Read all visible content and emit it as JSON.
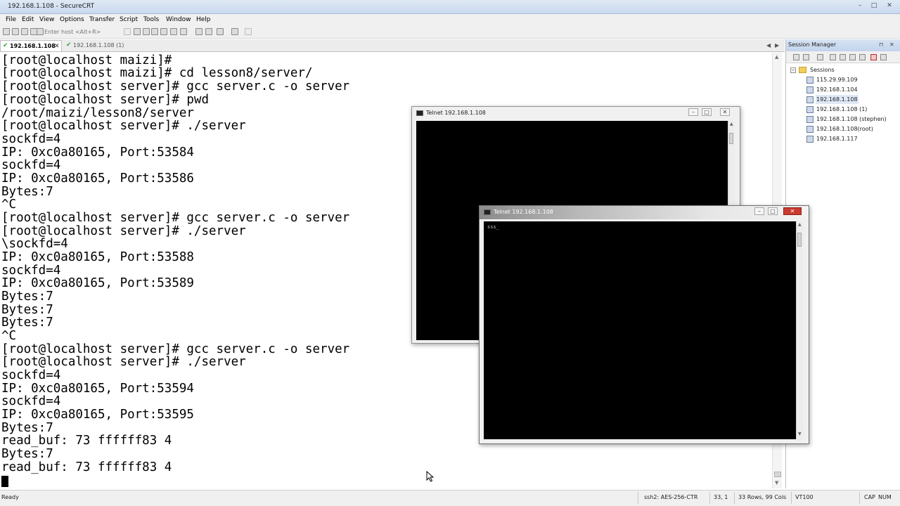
{
  "window": {
    "title": "192.168.1.108 - SecureCRT",
    "minimize": "–",
    "maximize": "□",
    "close": "✕"
  },
  "menu": [
    "File",
    "Edit",
    "View",
    "Options",
    "Transfer",
    "Script",
    "Tools",
    "Window",
    "Help"
  ],
  "toolbar": {
    "host_placeholder": "Enter host <Alt+R>",
    "icons": [
      "connect-icon",
      "quick-connect-icon",
      "connect-tab-icon",
      "reconnect-icon",
      "disconnect-icon",
      "copy-icon",
      "paste-icon",
      "copy-paste-icon",
      "find-icon",
      "print-icon",
      "session-options-icon",
      "global-options-icon",
      "keymap-icon",
      "sftp-icon",
      "help-icon",
      "options-icon"
    ]
  },
  "tabs": [
    {
      "label": "192.168.1.108",
      "active": true,
      "status": "✔"
    },
    {
      "label": "192.168.1.108 (1)",
      "active": false,
      "status": "✔"
    }
  ],
  "tab_close": "✕",
  "tab_nav": {
    "prev": "◀",
    "next": "▶"
  },
  "terminal": {
    "lines": [
      "[root@localhost maizi]#",
      "[root@localhost maizi]# cd lesson8/server/",
      "[root@localhost server]# gcc server.c -o server",
      "[root@localhost server]# pwd",
      "/root/maizi/lesson8/server",
      "[root@localhost server]# ./server",
      "sockfd=4",
      "IP: 0xc0a80165, Port:53584",
      "sockfd=4",
      "IP: 0xc0a80165, Port:53586",
      "Bytes:7",
      "^C",
      "[root@localhost server]# gcc server.c -o server",
      "[root@localhost server]# ./server",
      "\\sockfd=4",
      "IP: 0xc0a80165, Port:53588",
      "sockfd=4",
      "IP: 0xc0a80165, Port:53589",
      "Bytes:7",
      "Bytes:7",
      "Bytes:7",
      "^C",
      "[root@localhost server]# gcc server.c -o server",
      "[root@localhost server]# ./server",
      "sockfd=4",
      "IP: 0xc0a80165, Port:53594",
      "sockfd=4",
      "IP: 0xc0a80165, Port:53595",
      "Bytes:7",
      "read_buf: 73 ffffff83 4",
      "Bytes:7",
      "read_buf: 73 ffffff83 4"
    ]
  },
  "session_manager": {
    "title": "Session Manager",
    "pin": "⊓",
    "close": "✕",
    "root": "Sessions",
    "expander": "−",
    "sessions": [
      "115.29.99.109",
      "192.168.1.104",
      "192.168.1.108",
      "192.168.1.108 (1)",
      "192.168.1.108 (stephen)",
      "192.168.1.108(root)",
      "192.168.1.117"
    ],
    "selected_index": 2
  },
  "telnet_back": {
    "title": "Telnet 192.168.1.108",
    "content": ""
  },
  "telnet_front": {
    "title": "Telnet 192.168.1.108",
    "content": "sss_"
  },
  "status_bar": {
    "ready": "Ready",
    "cipher": "ssh2: AES-256-CTR",
    "position": "33,  1",
    "size": "33 Rows, 99 Cols",
    "term_type": "VT100",
    "caps": "CAP",
    "num": "NUM"
  },
  "scroll_arrows": {
    "up": "▲",
    "down": "▼"
  }
}
